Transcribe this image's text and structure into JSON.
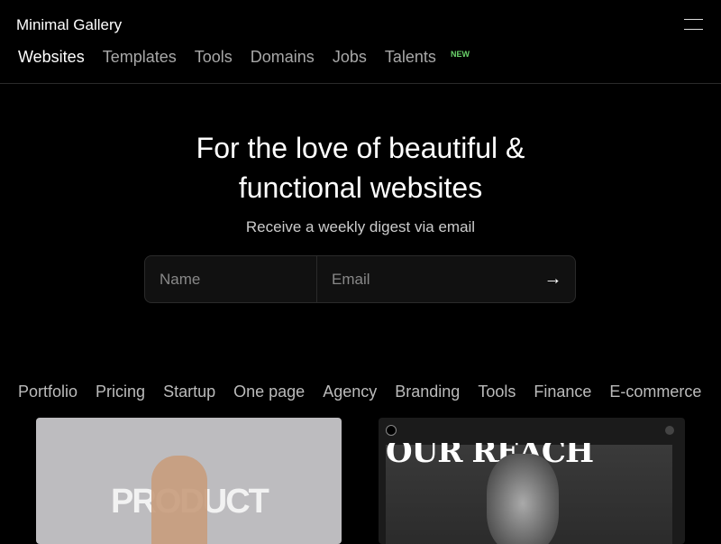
{
  "brand": "Minimal Gallery",
  "nav": [
    "Websites",
    "Templates",
    "Tools",
    "Domains",
    "Jobs",
    "Talents"
  ],
  "nav_badge": "NEW",
  "hero": {
    "title_line1": "For the love of beautiful &",
    "title_line2": "functional websites",
    "subtitle": "Receive a weekly digest via email"
  },
  "form": {
    "name_placeholder": "Name",
    "email_placeholder": "Email",
    "submit_icon": "→"
  },
  "categories": [
    "Portfolio",
    "Pricing",
    "Startup",
    "One page",
    "Agency",
    "Branding",
    "Tools",
    "Finance",
    "E-commerce"
  ],
  "cards": [
    {
      "image_text": "PRODUCT"
    },
    {
      "image_text": "OUR REACH"
    }
  ]
}
